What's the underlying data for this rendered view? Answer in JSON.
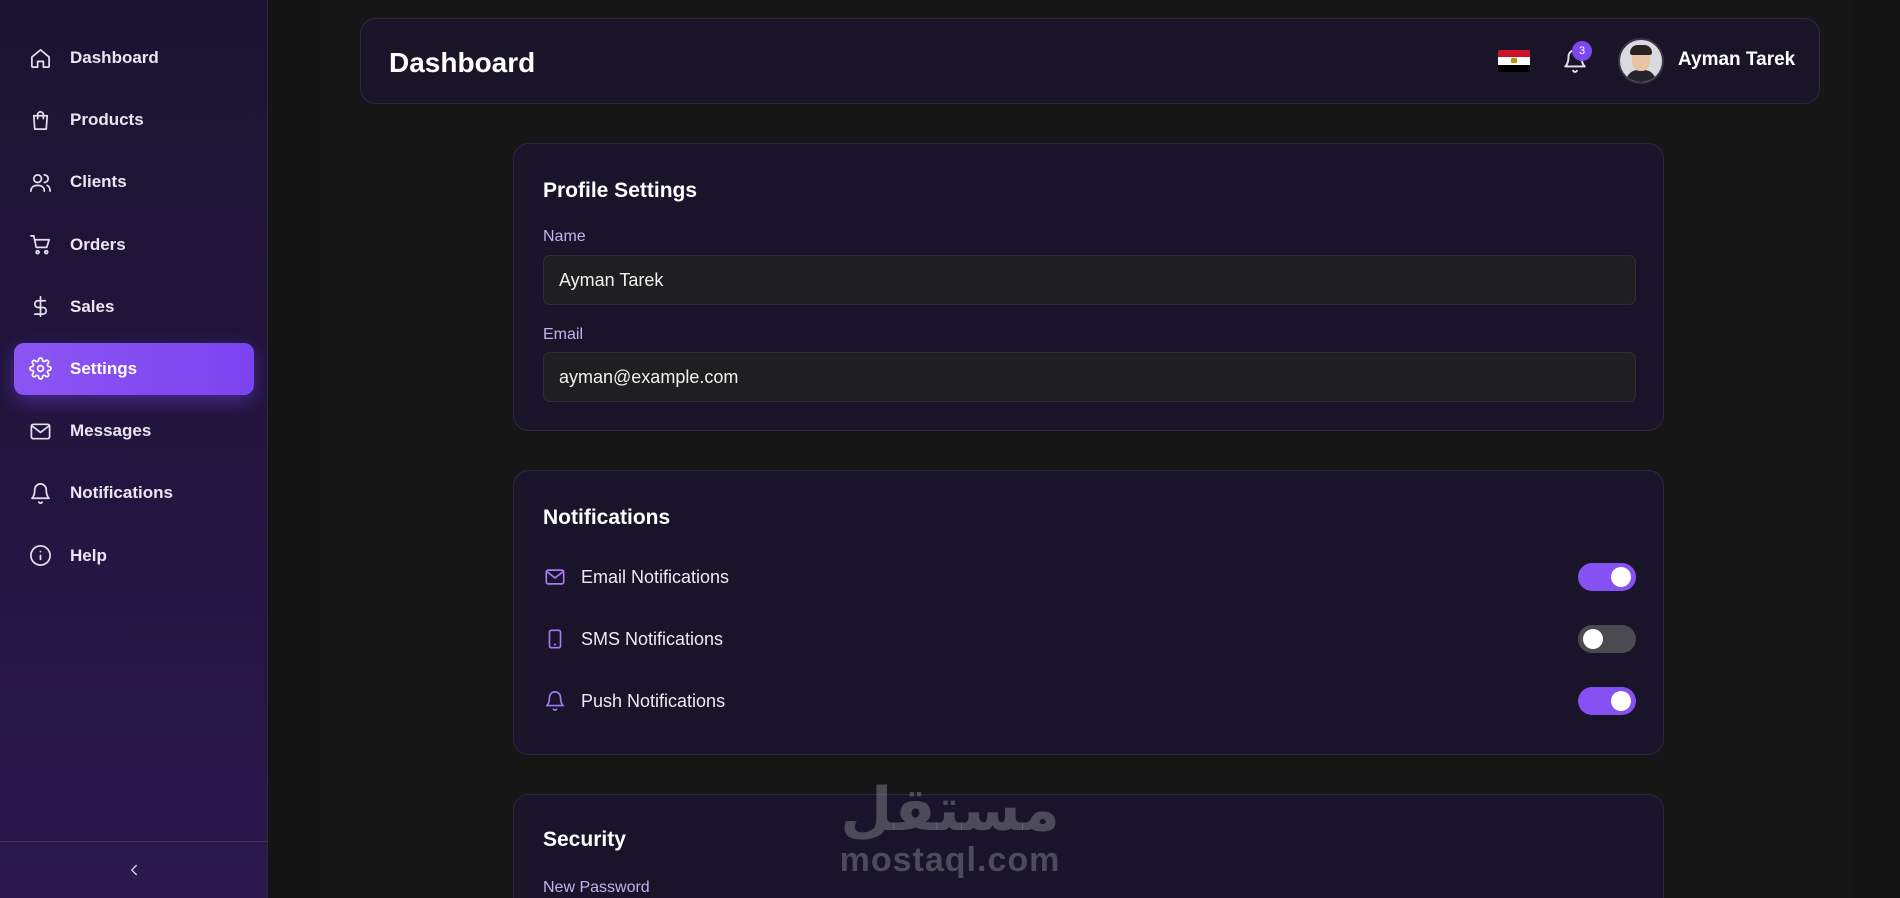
{
  "sidebar": {
    "items": [
      {
        "label": "Dashboard",
        "icon": "home-icon"
      },
      {
        "label": "Products",
        "icon": "shopping-bag-icon"
      },
      {
        "label": "Clients",
        "icon": "users-icon"
      },
      {
        "label": "Orders",
        "icon": "cart-icon"
      },
      {
        "label": "Sales",
        "icon": "dollar-icon"
      },
      {
        "label": "Settings",
        "icon": "gear-icon",
        "active": true
      },
      {
        "label": "Messages",
        "icon": "mail-icon"
      },
      {
        "label": "Notifications",
        "icon": "bell-icon"
      },
      {
        "label": "Help",
        "icon": "info-icon"
      }
    ],
    "collapse_icon": "chevron-left-icon"
  },
  "header": {
    "title": "Dashboard",
    "notification_count": "3",
    "user_name": "Ayman Tarek",
    "flag": "egypt-flag-icon"
  },
  "profile": {
    "title": "Profile Settings",
    "name_label": "Name",
    "name_value": "Ayman Tarek",
    "email_label": "Email",
    "email_value": "ayman@example.com"
  },
  "notifications": {
    "title": "Notifications",
    "items": [
      {
        "label": "Email Notifications",
        "icon": "mail-icon",
        "enabled": true
      },
      {
        "label": "SMS Notifications",
        "icon": "phone-icon",
        "enabled": false
      },
      {
        "label": "Push Notifications",
        "icon": "bell-icon",
        "enabled": true
      }
    ]
  },
  "security": {
    "title": "Security",
    "new_password_label": "New Password"
  },
  "watermark": {
    "arabic": "مستقل",
    "latin": "mostaql.com"
  },
  "colors": {
    "accent": "#8651f2",
    "sidebar_bg": "#221540",
    "card_bg": "#19142a",
    "label": "#c4b2ec",
    "toggle_off": "#4a4a50"
  }
}
